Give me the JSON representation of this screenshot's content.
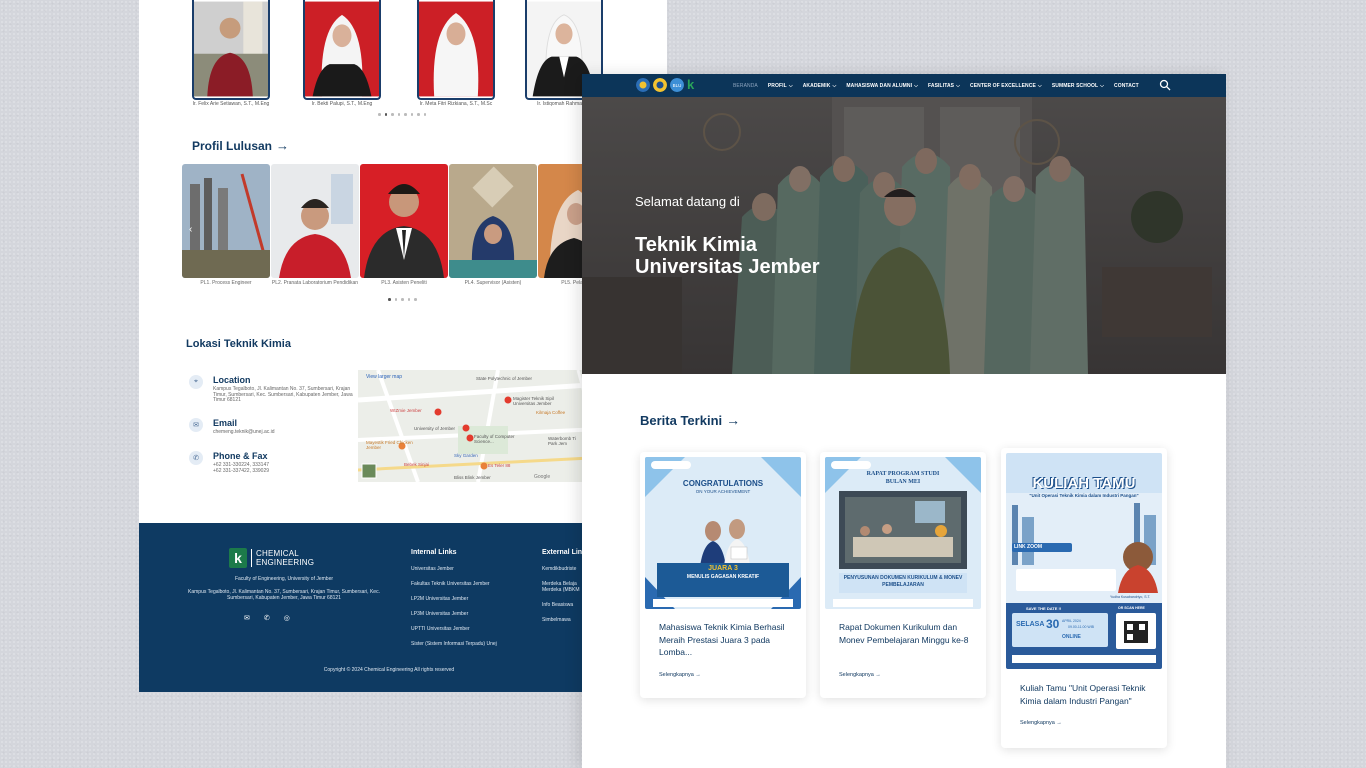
{
  "left_page": {
    "staff": [
      {
        "name": "Ir. Felix Arie Setiawan, S.T., M.Eng"
      },
      {
        "name": "Ir. Bekti Palupi, S.T., M.Eng"
      },
      {
        "name": "Ir. Meta Fitri Rizkiana, S.T., M.Sc"
      },
      {
        "name": "Ir. Istiqomah Rahmawati"
      }
    ],
    "alumni_title": "Profil Lulusan",
    "alumni": [
      {
        "label": "PL1. Process Engineer"
      },
      {
        "label": "PL2. Pranata Laboratorium Pendidikan"
      },
      {
        "label": "PL3. Asisten Peneliti"
      },
      {
        "label": "PL4. Supervisor (Asisten)"
      },
      {
        "label": "PL5. Pelaku Techn"
      }
    ],
    "location": {
      "title": "Lokasi Teknik Kimia",
      "location_head": "Location",
      "location_text": "Kampus Tegalboto, Jl. Kalimantan No. 37, Sumbersari, Krajan Timur, Sumbersari, Kec. Sumbersari, Kabupaten Jember, Jawa Timur 68121",
      "email_head": "Email",
      "email_text": "chemeng.teknik@unej.ac.id",
      "phone_head": "Phone & Fax",
      "phone_text": "+62 331-330224, 333147\n+62 331-337422, 339029"
    },
    "map": {
      "view_larger": "View larger map",
      "labels": [
        "State Polytechnic of Jember",
        "Magister Teknik Sipil Universitas Jember",
        "WIZmie Jember",
        "Kilmaja Coffee",
        "University of Jember",
        "Faculty of Computer Science...",
        "Mayestik Fried Chicken Jember",
        "Waterbomb Ti Park Jem",
        "Sky Garden",
        "Es Teler 88",
        "Bebek Sinjai",
        "Bakso Gatot 69",
        "Bliss Blink Jember",
        "KONTRAKAN",
        "Google"
      ]
    },
    "footer": {
      "brand_line1": "CHEMICAL",
      "brand_line2": "ENGINEERING",
      "faculty": "Faculty of Engineering, University of Jember",
      "address": "Kampus Tegalboto, Jl. Kalimantan No. 37, Sumbersari, Krajan Timur, Sumbersari, Kec. Sumbersari, Kabupaten Jember, Jawa Timur 68121",
      "internal_title": "Internal Links",
      "internal_links": [
        "Universitas Jember",
        "Fakultas Teknik Universitas Jember",
        "LP2M Universitas Jember",
        "LP3M Universitas Jember",
        "UPTTI Universitas Jember",
        "Sister (Sistem Informasi Terpadu) Unej"
      ],
      "external_title": "External Lin",
      "external_links": [
        "Kemdikbudriste",
        "Merdeka Belaja",
        "Merdeka (MBKM",
        "Info Beasiswa",
        "Simbelmawa"
      ],
      "copyright": "Copyright © 2024 Chemical Engineering All rights reserved"
    }
  },
  "right_page": {
    "nav": {
      "items": [
        {
          "label": "BERANDA",
          "active": true,
          "dropdown": false
        },
        {
          "label": "PROFIL",
          "dropdown": true
        },
        {
          "label": "AKADEMIK",
          "dropdown": true
        },
        {
          "label": "MAHASISWA DAN ALUMNI",
          "dropdown": true
        },
        {
          "label": "FASILITAS",
          "dropdown": true
        },
        {
          "label": "CENTER OF EXCELLENCE",
          "dropdown": true
        },
        {
          "label": "SUMMER SCHOOL",
          "dropdown": true
        },
        {
          "label": "CONTACT",
          "dropdown": false
        }
      ],
      "logo_text": "BLU"
    },
    "hero": {
      "subtitle": "Selamat datang di",
      "title_line1": "Teknik Kimia",
      "title_line2": "Universitas Jember"
    },
    "news_title": "Berita Terkini",
    "news": [
      {
        "poster_head": "CONGRATULATIONS",
        "poster_sub": "ON YOUR ACHIEVEMENT",
        "poster_award": "JUARA 3",
        "poster_award_sub": "MENULIS GAGASAN KREATIF",
        "title": "Mahasiswa Teknik Kimia Berhasil Meraih Prestasi Juara 3 pada Lomba...",
        "more": "Selengkapnya"
      },
      {
        "poster_head": "RAPAT PROGRAM STUDI",
        "poster_sub": "BULAN MEI",
        "poster_caption": "PENYUSUNAN DOKUMEN KURIKULUM & MONEV PEMBELAJARAN",
        "title": "Rapat Dokumen Kurikulum dan Monev Pembelajaran Minggu ke-8",
        "more": "Selengkapnya"
      },
      {
        "poster_head": "KULIAH TAMU",
        "poster_sub": "\"Unit Operasi Teknik Kimia dalam Industri Pangan\"",
        "poster_zoom": "LINK ZOOM",
        "poster_speaker": "Yudha Kusabandriyo, S.T.",
        "poster_day": "SELASA",
        "poster_date": "30",
        "poster_month": "APRIL 2024",
        "poster_time": "09.00-11.00 WIB",
        "poster_mode": "ONLINE",
        "poster_save": "SAVE THE DATE !!",
        "poster_scan": "OR SCAN HERE",
        "title": "Kuliah Tamu \"Unit Operasi Teknik Kimia dalam Industri Pangan\"",
        "more": "Selengkapnya"
      }
    ]
  },
  "colors": {
    "navy": "#123a61",
    "footer_bg": "#0e3a62",
    "nav_bg": "#0c3559",
    "poster_blue": "#2a6ab1",
    "poster_light": "#cfe3f5"
  }
}
